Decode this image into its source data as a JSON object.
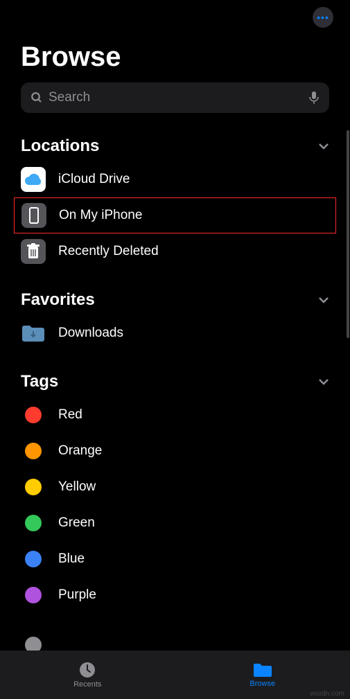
{
  "header": {
    "title": "Browse"
  },
  "search": {
    "placeholder": "Search"
  },
  "sections": {
    "locations": {
      "title": "Locations",
      "items": [
        {
          "label": "iCloud Drive",
          "icon": "cloud"
        },
        {
          "label": "On My iPhone",
          "icon": "phone",
          "highlighted": true
        },
        {
          "label": "Recently Deleted",
          "icon": "trash"
        }
      ]
    },
    "favorites": {
      "title": "Favorites",
      "items": [
        {
          "label": "Downloads",
          "icon": "folder"
        }
      ]
    },
    "tags": {
      "title": "Tags",
      "items": [
        {
          "label": "Red",
          "color": "#ff3b2f"
        },
        {
          "label": "Orange",
          "color": "#ff9500"
        },
        {
          "label": "Yellow",
          "color": "#ffcc00"
        },
        {
          "label": "Green",
          "color": "#34c759"
        },
        {
          "label": "Blue",
          "color": "#3b82f7"
        },
        {
          "label": "Purple",
          "color": "#af52de"
        }
      ]
    }
  },
  "tabs": {
    "recents": "Recents",
    "browse": "Browse"
  },
  "watermark": "wsxdn.com"
}
